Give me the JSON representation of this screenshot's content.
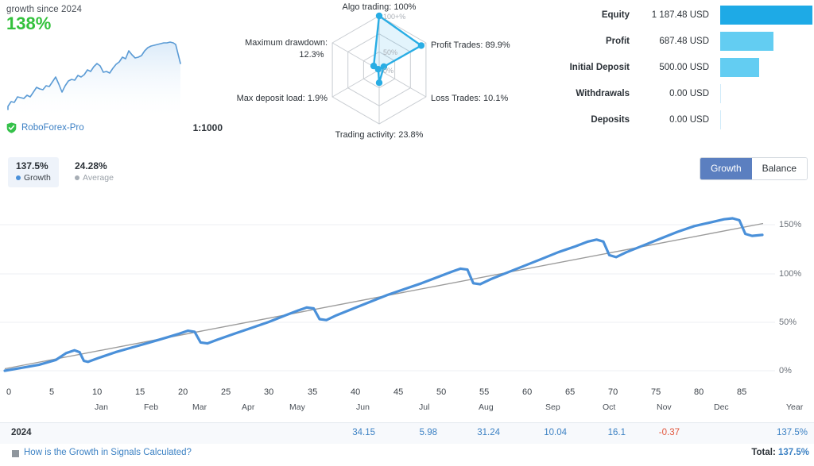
{
  "summary": {
    "growth_label": "growth since 2024",
    "growth_value": "138%",
    "account_name": "RoboForex-Pro",
    "leverage": "1:1000",
    "badge_icon": "verified-shield-icon",
    "growth_color": "#33c13c",
    "line_color": "#5b9bd5"
  },
  "radar": {
    "scale_labels": [
      "100+%",
      "50%",
      "0%"
    ],
    "axes": [
      {
        "label": "Algo trading: 100%",
        "name": "algo-trading",
        "value": 100
      },
      {
        "label": "Profit Trades: 89.9%",
        "name": "profit-trades",
        "value": 89.9
      },
      {
        "label": "Loss Trades: 10.1%",
        "name": "loss-trades",
        "value": 10.1
      },
      {
        "label": "Trading activity: 23.8%",
        "name": "trading-activity",
        "value": 23.8
      },
      {
        "label": "Max deposit load: 1.9%",
        "name": "max-deposit-load",
        "value": 1.9
      },
      {
        "label": "Maximum drawdown:",
        "label2": "12.3%",
        "name": "maximum-drawdown",
        "value": 12.3
      }
    ],
    "accent": "#29ade4"
  },
  "stats": {
    "rows": [
      {
        "name": "Equity",
        "value": "1 187.48 USD",
        "bar_pct": 100,
        "color": "#1eaae6"
      },
      {
        "name": "Profit",
        "value": "687.48 USD",
        "bar_pct": 57.9,
        "color": "#63cdf2"
      },
      {
        "name": "Initial Deposit",
        "value": "500.00 USD",
        "bar_pct": 42.1,
        "color": "#63cdf2"
      },
      {
        "name": "Withdrawals",
        "value": "0.00 USD",
        "bar_pct": 0,
        "color": "#63cdf2"
      },
      {
        "name": "Deposits",
        "value": "0.00 USD",
        "bar_pct": 0,
        "color": "#63cdf2"
      }
    ]
  },
  "legend": {
    "growth": {
      "value": "137.5%",
      "label": "Growth",
      "color": "#4a90d9"
    },
    "average": {
      "value": "24.28%",
      "label": "Average",
      "color": "#a7aeb5"
    }
  },
  "toggle": {
    "growth": "Growth",
    "balance": "Balance",
    "selected": "Growth"
  },
  "chart_data": {
    "type": "line",
    "title": "",
    "xlabel": "",
    "ylabel": "",
    "ylim": [
      -12,
      162
    ],
    "yticks": [
      0,
      50,
      100,
      150
    ],
    "ytick_labels": [
      "0%",
      "50%",
      "100%",
      "150%"
    ],
    "grid": true,
    "xlim": [
      0,
      89
    ],
    "xticks": [
      0,
      5,
      10,
      15,
      20,
      25,
      30,
      35,
      40,
      45,
      50,
      55,
      60,
      65,
      70,
      75,
      80,
      85
    ],
    "xtick_labels": [
      "0",
      "5",
      "10",
      "15",
      "20",
      "25",
      "30",
      "35",
      "40",
      "45",
      "50",
      "55",
      "60",
      "65",
      "70",
      "75",
      "80",
      "85"
    ],
    "month_labels": [
      "Jan",
      "Feb",
      "Mar",
      "Apr",
      "May",
      "Jun",
      "Jul",
      "Aug",
      "Sep",
      "Oct",
      "Nov",
      "Dec",
      "Year"
    ],
    "legend_position": "top-left",
    "series": [
      {
        "name": "Growth",
        "color": "#4a90d9",
        "points": [
          [
            0,
            0
          ],
          [
            2,
            3
          ],
          [
            4,
            6
          ],
          [
            6,
            11
          ],
          [
            7.2,
            18
          ],
          [
            8.2,
            21
          ],
          [
            8.8,
            19
          ],
          [
            9.3,
            10
          ],
          [
            9.8,
            9
          ],
          [
            11,
            13
          ],
          [
            13,
            19
          ],
          [
            15,
            24
          ],
          [
            17,
            29
          ],
          [
            19,
            34
          ],
          [
            20.5,
            38
          ],
          [
            21.5,
            41
          ],
          [
            22.3,
            40
          ],
          [
            23,
            30
          ],
          [
            23.8,
            29
          ],
          [
            25,
            33
          ],
          [
            27,
            39
          ],
          [
            29,
            45
          ],
          [
            31,
            51
          ],
          [
            33,
            58
          ],
          [
            34.5,
            63
          ],
          [
            35.5,
            66
          ],
          [
            36.3,
            65
          ],
          [
            37,
            54
          ],
          [
            37.8,
            53
          ],
          [
            39,
            57
          ],
          [
            41,
            62
          ],
          [
            43,
            67
          ],
          [
            45,
            72
          ],
          [
            47,
            78
          ],
          [
            49,
            84
          ],
          [
            51,
            91
          ],
          [
            52.5,
            96
          ],
          [
            53.5,
            99
          ],
          [
            54.3,
            98
          ],
          [
            55,
            84
          ],
          [
            55.8,
            83
          ],
          [
            57,
            88
          ],
          [
            59,
            95
          ],
          [
            61,
            102
          ],
          [
            63,
            109
          ],
          [
            65,
            116
          ],
          [
            67,
            122
          ],
          [
            68.5,
            127
          ],
          [
            69.5,
            129
          ],
          [
            70.3,
            128
          ],
          [
            71,
            118
          ],
          [
            71.8,
            117
          ],
          [
            73,
            122
          ],
          [
            75,
            129
          ],
          [
            77,
            136
          ],
          [
            79,
            143
          ],
          [
            81,
            149
          ],
          [
            83,
            153
          ],
          [
            84.5,
            156
          ],
          [
            85.5,
            157
          ],
          [
            86.3,
            155
          ],
          [
            87,
            141
          ],
          [
            87.8,
            139
          ],
          [
            89,
            140
          ]
        ]
      },
      {
        "name": "Average",
        "color": "#9b9b9b",
        "points": [
          [
            0,
            2
          ],
          [
            89,
            152
          ]
        ]
      }
    ]
  },
  "table": {
    "year_label": "2024",
    "cells": [
      {
        "month": "Jun",
        "value": "34.15",
        "negative": false
      },
      {
        "month": "Jul",
        "value": "5.98",
        "negative": false
      },
      {
        "month": "Aug",
        "value": "31.24",
        "negative": false
      },
      {
        "month": "Sep",
        "value": "10.04",
        "negative": false
      },
      {
        "month": "Oct",
        "value": "16.1",
        "negative": false
      },
      {
        "month": "Nov",
        "value": "-0.37",
        "negative": true
      },
      {
        "month": "Year",
        "value": "137.5%",
        "negative": false
      }
    ]
  },
  "footer": {
    "icon": "info-icon",
    "link": "How is the Growth in Signals Calculated?",
    "total_label": "Total:",
    "total_value": "137.5%"
  }
}
